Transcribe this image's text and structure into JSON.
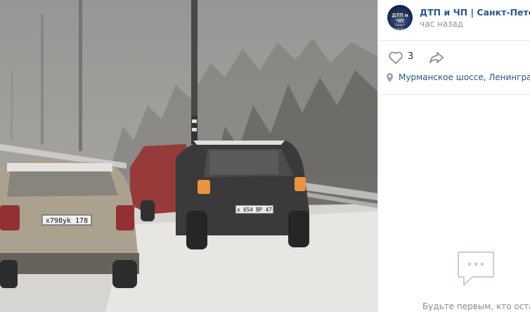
{
  "photo": {
    "plates": [
      "x798yk 178",
      "x 654 BP 47"
    ]
  },
  "post": {
    "group_name": "ДТП и ЧП | Санкт-Петербург",
    "avatar_text_line1": "ДТП и ЧП",
    "avatar_text_line2": "Санкт-Петербург",
    "time": "час назад",
    "likes": "3",
    "location": "Мурманское шоссе, Ленинградская область"
  },
  "comments": {
    "empty_text": "Будьте первым, кто оставит комментарий"
  },
  "colors": {
    "link": "#2a5885",
    "muted": "#939393",
    "icon": "#828a99"
  },
  "icons": [
    "heart-icon",
    "share-icon",
    "location-pin-icon",
    "comment-icon"
  ]
}
